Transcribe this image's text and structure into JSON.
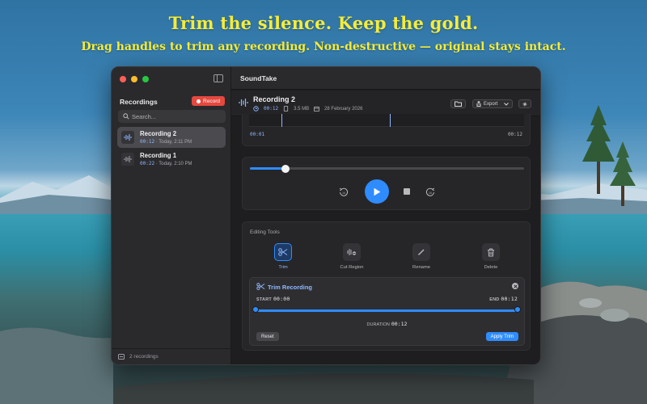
{
  "hero": {
    "headline": "Trim the silence. Keep the gold.",
    "subheadline": "Drag handles to trim any recording. Non-destructive — original stays intact."
  },
  "colors": {
    "accent": "#2f8cff",
    "record": "#e5483e",
    "headline": "#f6ec38"
  },
  "sidebar": {
    "title": "Recordings",
    "record_label": "Record",
    "search_placeholder": "Search...",
    "items": [
      {
        "name": "Recording 2",
        "duration": "00:12",
        "time": "Today, 2:11 PM",
        "selected": true
      },
      {
        "name": "Recording 1",
        "duration": "00:22",
        "time": "Today, 2:10 PM",
        "selected": false
      }
    ],
    "footer": "2 recordings"
  },
  "main": {
    "app_title": "SoundTake",
    "recording": {
      "name": "Recording 2",
      "duration": "00:12",
      "size": "3.5 MB",
      "date": "28 February 2026"
    },
    "export_label": "Export",
    "waveform": {
      "start_time": "00:01",
      "end_time": "00:12"
    },
    "player": {
      "progress_fraction": 0.13
    },
    "editing": {
      "title": "Editing Tools",
      "tools": [
        {
          "label": "Trim",
          "icon": "scissors-icon",
          "active": true
        },
        {
          "label": "Cut Region",
          "icon": "cut-region-icon",
          "active": false
        },
        {
          "label": "Rename",
          "icon": "pencil-icon",
          "active": false
        },
        {
          "label": "Delete",
          "icon": "trash-icon",
          "active": false
        }
      ],
      "trim": {
        "title": "Trim Recording",
        "start_label": "START",
        "start_value": "00:00",
        "end_label": "END",
        "end_value": "00:12",
        "duration_label": "DURATION",
        "duration_value": "00:12",
        "reset_label": "Reset",
        "apply_label": "Apply Trim"
      }
    }
  }
}
